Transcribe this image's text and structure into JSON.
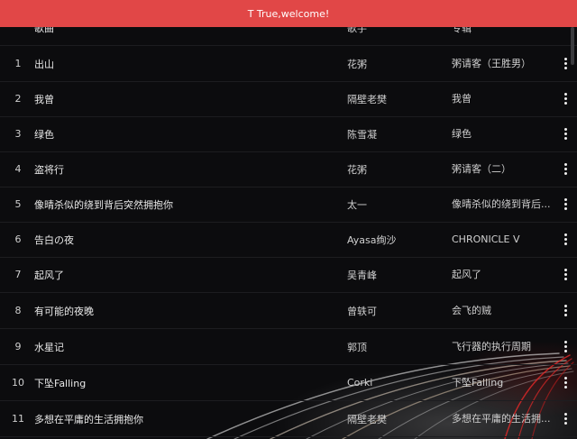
{
  "toast": {
    "text": "T True,welcome!"
  },
  "header": {
    "song": "歌曲",
    "artist": "歌手",
    "album": "专辑"
  },
  "rows": [
    {
      "index": "1",
      "song": "出山",
      "artist": "花粥",
      "album": "粥请客（王胜男）"
    },
    {
      "index": "2",
      "song": "我曾",
      "artist": "隔壁老樊",
      "album": "我曾"
    },
    {
      "index": "3",
      "song": "绿色",
      "artist": "陈雪凝",
      "album": "绿色"
    },
    {
      "index": "4",
      "song": "盗将行",
      "artist": "花粥",
      "album": "粥请客（二）"
    },
    {
      "index": "5",
      "song": "像晴杀似的绕到背后突然拥抱你",
      "artist": "太一",
      "album": "像晴杀似的绕到背后..."
    },
    {
      "index": "6",
      "song": "告白の夜",
      "artist": "Ayasa绚沙",
      "album": "CHRONICLE V"
    },
    {
      "index": "7",
      "song": "起风了",
      "artist": "吴青峰",
      "album": "起风了"
    },
    {
      "index": "8",
      "song": "有可能的夜晚",
      "artist": "曾轶可",
      "album": "会飞的贼"
    },
    {
      "index": "9",
      "song": "水星记",
      "artist": "郭顶",
      "album": "飞行器的执行周期"
    },
    {
      "index": "10",
      "song": "下坠Falling",
      "artist": "Corki",
      "album": "下坠Falling"
    },
    {
      "index": "11",
      "song": "多想在平庸的生活拥抱你",
      "artist": "隔壁老樊",
      "album": "多想在平庸的生活拥..."
    }
  ],
  "icons": {
    "more": "more-vertical-icon"
  },
  "colors": {
    "toast": "#e14747",
    "background": "#0c0c0e"
  }
}
